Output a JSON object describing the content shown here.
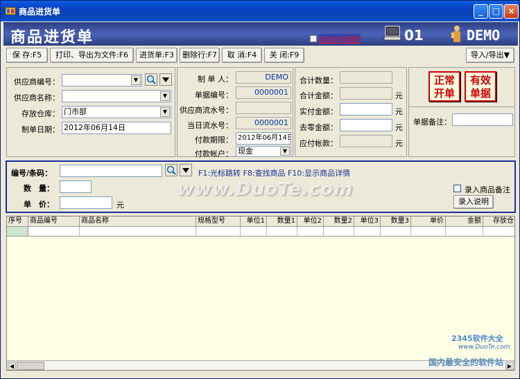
{
  "window": {
    "title": "商品进货单",
    "min": "_",
    "max": "□",
    "close": "×"
  },
  "banner": {
    "title": "商品进货单",
    "link_text": "商品价格调整",
    "user_no": "01",
    "demo": "DEMO"
  },
  "toolbar": {
    "save": "保 存:F5",
    "print": "打印、导出为文件:F6",
    "purchase": "进货单:F3",
    "delete_row": "删除行:F7",
    "cancel": "取 消:F4",
    "close": "关 闭:F9",
    "import_export": "导入/导出▼"
  },
  "form_left": {
    "supplier_code_label": "供应商编号：",
    "supplier_code": "",
    "supplier_name_label": "供应商名称：",
    "supplier_name": "",
    "warehouse_label": "存放仓库：",
    "warehouse": "门市部",
    "date_label": "制单日期：",
    "date": "2012年06月14日"
  },
  "form_mid": {
    "maker_label": "制 单 人：",
    "maker": "DEMO",
    "doc_no_label": "单据编号：",
    "doc_no": "0000001",
    "supplier_serial_label": "供应商流水号：",
    "supplier_serial": "",
    "day_serial_label": "当日流水号：",
    "day_serial": "0000001",
    "pay_due_label": "付款期限：",
    "pay_due": "2012年06月14日",
    "pay_account_label": "付款帐户：",
    "pay_account": "现金"
  },
  "form_right": {
    "total_qty_label": "合计数量：",
    "total_qty": "",
    "total_amt_label": "合计金额：",
    "total_amt": "",
    "paid_label": "实付金额：",
    "paid": "",
    "rounding_label": "去零金额：",
    "rounding": "",
    "payable_label": "应付帐款：",
    "payable": "",
    "unit": "元"
  },
  "stamps": {
    "normal": "正常开单",
    "valid": "有效单据"
  },
  "remark": {
    "label": "单据备注：",
    "value": ""
  },
  "entry": {
    "code_label": "编号/条码：",
    "code": "",
    "qty_label": "数　量：",
    "qty": "",
    "price_label": "单　价：",
    "price": "",
    "unit": "元",
    "hints": "F1:光标跳转  F8:查找商品  F10:显示商品详情",
    "note_checkbox_label": "录入商品备注",
    "note_button": "录入说明"
  },
  "grid": {
    "columns": [
      "序号",
      "商品编号",
      "商品名称",
      "规格型号",
      "单位1",
      "数量1",
      "单位2",
      "数量2",
      "单位3",
      "数量3",
      "单价",
      "金额",
      "存放仓"
    ]
  },
  "watermark": {
    "main": "www.DuoTe.com",
    "site": "2345软件大全",
    "url": "www.DuoTe.com",
    "slogan": "国内最安全的软件站"
  }
}
